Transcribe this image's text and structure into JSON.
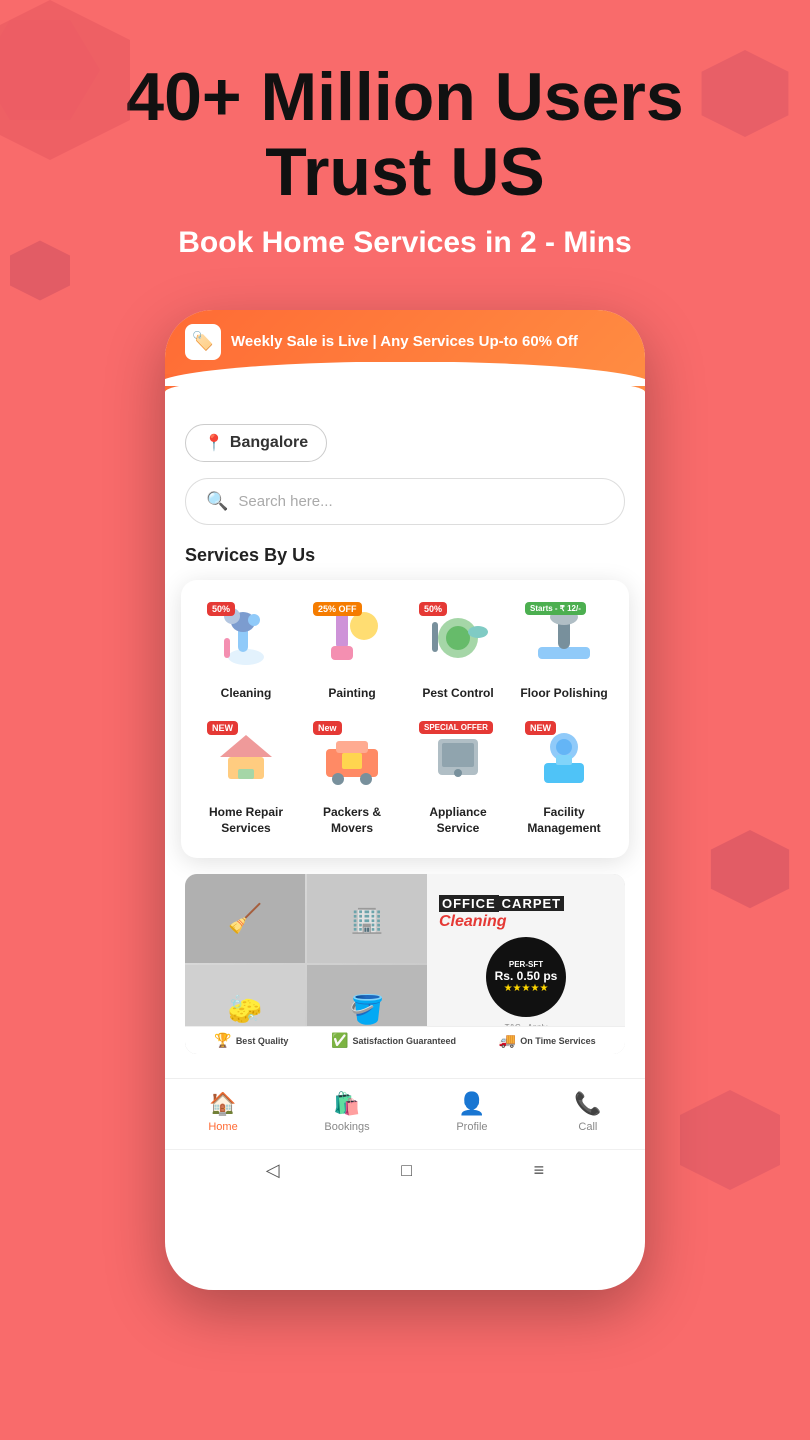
{
  "hero": {
    "title": "40+ Million Users Trust US",
    "subtitle": "Book Home Services in 2 - Mins"
  },
  "phone": {
    "banner": {
      "icon": "🏷️",
      "text": "Weekly Sale is Live | Any Services Up-to 60% Off"
    },
    "location": {
      "placeholder": "Bangalore"
    },
    "search": {
      "placeholder": "Search here..."
    },
    "section_title": "Services By Us",
    "services": [
      {
        "id": "cleaning",
        "name": "Cleaning",
        "badge": "50%",
        "badge_type": "red",
        "emoji": "🧹"
      },
      {
        "id": "painting",
        "name": "Painting",
        "badge": "25% OFF",
        "badge_type": "orange",
        "emoji": "🎨"
      },
      {
        "id": "pest-control",
        "name": "Pest Control",
        "badge": "50%",
        "badge_type": "red",
        "emoji": "🦟"
      },
      {
        "id": "floor-polishing",
        "name": "Floor Polishing",
        "badge": "Starts - ₹ 12/-",
        "badge_type": "starts",
        "emoji": "🧽"
      },
      {
        "id": "home-repair",
        "name": "Home Repair Services",
        "badge": "NEW",
        "badge_type": "new",
        "emoji": "🔧"
      },
      {
        "id": "packers-movers",
        "name": "Packers & Movers",
        "badge": "New",
        "badge_type": "new",
        "emoji": "📦"
      },
      {
        "id": "appliance-service",
        "name": "Appliance Service",
        "badge": "SPECIAL OFFER",
        "badge_type": "special",
        "emoji": "🔌"
      },
      {
        "id": "facility-management",
        "name": "Facility Management",
        "badge": "NEW",
        "badge_type": "new",
        "emoji": "👷"
      }
    ],
    "promo": {
      "title": "OFFICE",
      "title_highlight": "CARPET",
      "subtitle": "Cleaning",
      "price_label": "PER-SFT",
      "price_value": "Rs. 0.50 ps",
      "stars": "★★★★★",
      "tc": "T&C - Apply",
      "footer_items": [
        {
          "icon": "🏆",
          "label": "Best Quality"
        },
        {
          "icon": "✅",
          "label": "Satisfaction Guaranteed"
        },
        {
          "icon": "🚚",
          "label": "On Time Services"
        }
      ],
      "dots": [
        true,
        false,
        false,
        false,
        false
      ]
    },
    "bottom_nav": [
      {
        "id": "home",
        "label": "Home",
        "icon": "🏠",
        "active": true
      },
      {
        "id": "bookings",
        "label": "Bookings",
        "icon": "🛍️",
        "active": false
      },
      {
        "id": "profile",
        "label": "Profile",
        "icon": "👤",
        "active": false
      },
      {
        "id": "call",
        "label": "Call",
        "icon": "📞",
        "active": false
      }
    ]
  },
  "colors": {
    "primary": "#F96B6B",
    "accent": "#FF6B35",
    "active_nav": "#FF6B35"
  }
}
